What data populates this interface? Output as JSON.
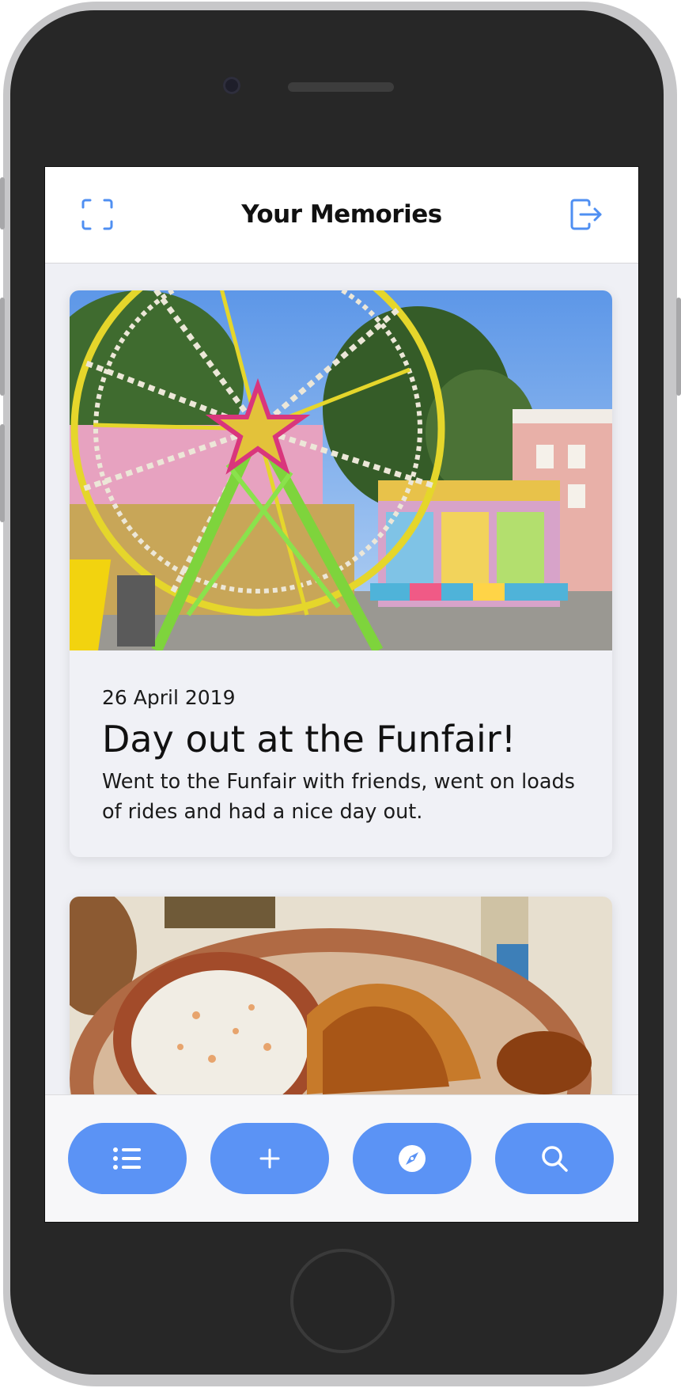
{
  "header": {
    "title": "Your Memories",
    "left_icon": "scan-frame-icon",
    "right_icon": "logout-icon"
  },
  "memories": [
    {
      "date": "26 April 2019",
      "title": "Day out at the Funfair!",
      "description": "Went to the Funfair with friends, went on loads of rides and had a nice day out.",
      "photo": "ferris-wheel-funfair-photo"
    },
    {
      "photo": "chicken-and-coleslaw-plate-photo"
    }
  ],
  "tabbar": {
    "items": [
      {
        "icon": "list-icon"
      },
      {
        "icon": "plus-icon"
      },
      {
        "icon": "compass-icon"
      },
      {
        "icon": "search-icon"
      }
    ]
  },
  "colors": {
    "accent": "#5b93f5",
    "background": "#eff0f5",
    "phone_body": "#272727"
  }
}
